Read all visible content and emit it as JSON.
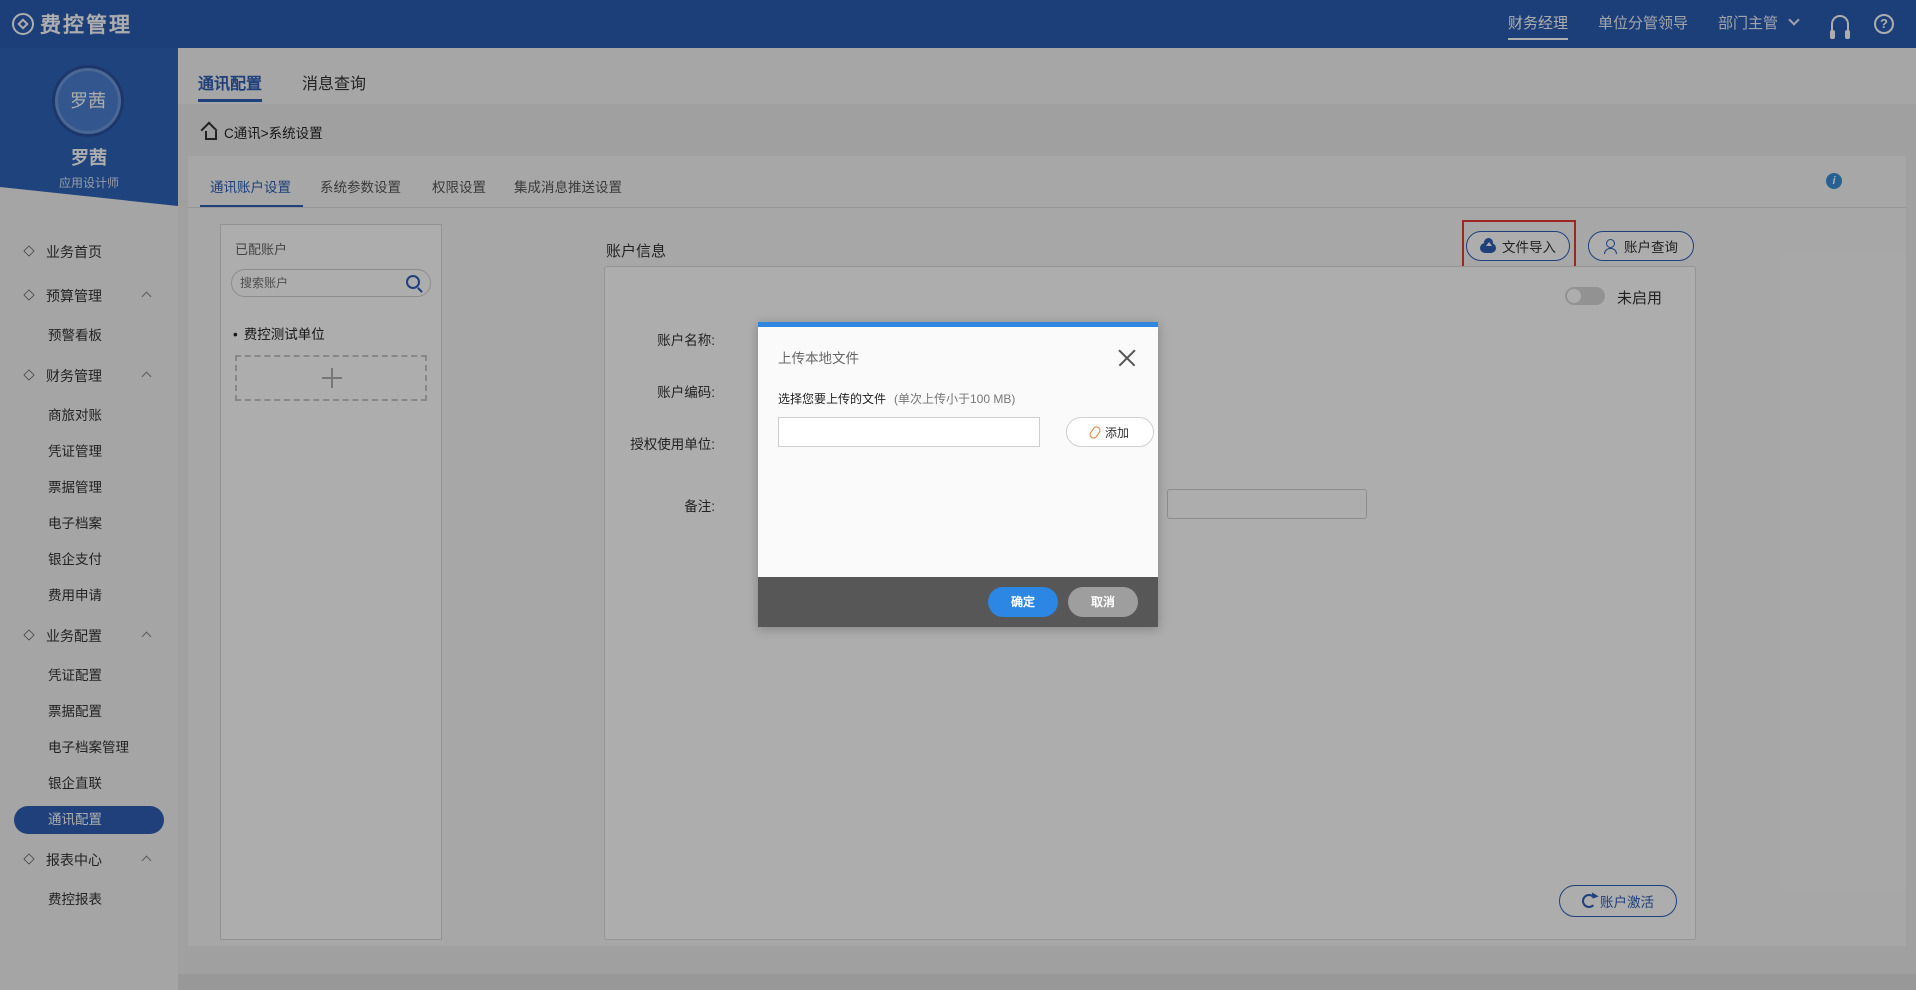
{
  "app": {
    "title": "费控管理"
  },
  "header": {
    "roles": [
      "财务经理",
      "单位分管领导",
      "部门主管"
    ],
    "icons": [
      "headset-icon",
      "help-icon"
    ],
    "help_glyph": "?"
  },
  "user": {
    "avatar_text": "罗茜",
    "name": "罗茜",
    "role": "应用设计师"
  },
  "sidebar": {
    "home": "业务首页",
    "budget": {
      "label": "预算管理",
      "items": [
        "预警看板"
      ]
    },
    "finance": {
      "label": "财务管理",
      "items": [
        "商旅对账",
        "凭证管理",
        "票据管理",
        "电子档案",
        "银企支付",
        "费用申请"
      ]
    },
    "config": {
      "label": "业务配置",
      "items": [
        "凭证配置",
        "票据配置",
        "电子档案管理",
        "银企直联",
        "通讯配置"
      ]
    },
    "report": {
      "label": "报表中心",
      "items": [
        "费控报表"
      ]
    }
  },
  "main_tabs": [
    "通讯配置",
    "消息查询"
  ],
  "breadcrumb": "C通讯>系统设置",
  "sub_tabs": [
    "通讯账户设置",
    "系统参数设置",
    "权限设置",
    "集成消息推送设置"
  ],
  "info_glyph": "i",
  "accounts_panel": {
    "title": "已配账户",
    "search_placeholder": "搜索账户",
    "items": [
      "费控测试单位"
    ]
  },
  "account_info": {
    "title": "账户信息",
    "import_label": "文件导入",
    "query_label": "账户查询",
    "status_label": "未启用",
    "fields": [
      "账户名称:",
      "账户编码:",
      "授权使用单位:",
      "备注:"
    ],
    "activate_label": "账户激活"
  },
  "modal": {
    "title": "上传本地文件",
    "prompt": "选择您要上传的文件",
    "hint": "(单次上传小于100 MB)",
    "add_label": "添加",
    "ok_label": "确定",
    "cancel_label": "取消"
  },
  "colors": {
    "brand": "#2a5db3",
    "highlight": "#e53935",
    "primary_button": "#2b86e4"
  }
}
